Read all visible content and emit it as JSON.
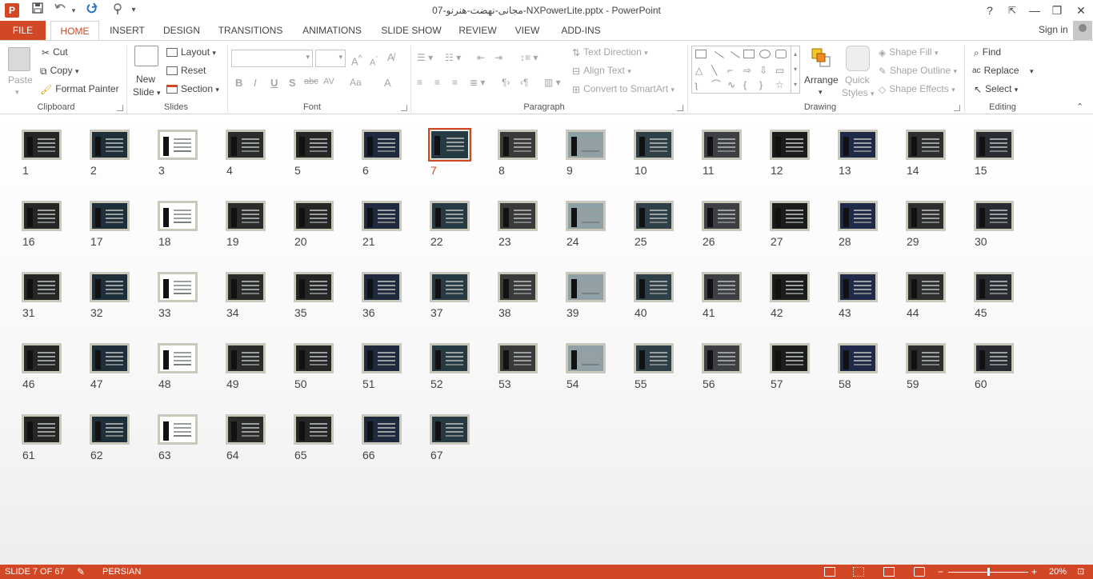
{
  "window": {
    "title": "07-مجانی-نهضت-هنرنو-NXPowerLite.pptx - PowerPoint",
    "help": "?",
    "restore_ribbon": "⇱",
    "minimize": "—",
    "maximize": "❐",
    "close": "✕"
  },
  "qat": {
    "save": "save-icon",
    "undo": "undo-icon",
    "redo": "redo-icon",
    "touch": "touch-mode-icon",
    "customize": "▾"
  },
  "tabs": [
    "FILE",
    "HOME",
    "INSERT",
    "DESIGN",
    "TRANSITIONS",
    "ANIMATIONS",
    "SLIDE SHOW",
    "REVIEW",
    "VIEW",
    "ADD-INS"
  ],
  "active_tab": "HOME",
  "account": {
    "signin": "Sign in"
  },
  "ribbon": {
    "clipboard": {
      "label": "Clipboard",
      "paste": "Paste",
      "cut": "Cut",
      "copy": "Copy",
      "format_painter": "Format Painter"
    },
    "slides": {
      "label": "Slides",
      "new_slide_1": "New",
      "new_slide_2": "Slide",
      "layout": "Layout",
      "reset": "Reset",
      "section": "Section"
    },
    "font": {
      "label": "Font",
      "bold": "B",
      "italic": "I",
      "underline": "U",
      "shadow": "S",
      "strike": "abc",
      "spacing": "AV",
      "case": "Aa",
      "color": "A",
      "grow": "A",
      "shrink": "A"
    },
    "paragraph": {
      "label": "Paragraph",
      "text_direction": "Text Direction",
      "align_text": "Align Text",
      "convert_smartart": "Convert to SmartArt"
    },
    "drawing": {
      "label": "Drawing",
      "arrange": "Arrange",
      "quick_styles_1": "Quick",
      "quick_styles_2": "Styles",
      "shape_fill": "Shape Fill",
      "shape_outline": "Shape Outline",
      "shape_effects": "Shape Effects"
    },
    "editing": {
      "label": "Editing",
      "find": "Find",
      "replace": "Replace",
      "select": "Select"
    }
  },
  "slides": {
    "count": 67,
    "selected": 7,
    "numbers": [
      "1",
      "2",
      "3",
      "4",
      "5",
      "6",
      "7",
      "8",
      "9",
      "10",
      "11",
      "12",
      "13",
      "14",
      "15",
      "16",
      "17",
      "18",
      "19",
      "20",
      "21",
      "22",
      "23",
      "24",
      "25",
      "26",
      "27",
      "28",
      "29",
      "30",
      "31",
      "32",
      "33",
      "34",
      "35",
      "36",
      "37",
      "38",
      "39",
      "40",
      "41",
      "42",
      "43",
      "44",
      "45",
      "46",
      "47",
      "48",
      "49",
      "50",
      "51",
      "52",
      "53",
      "54",
      "55",
      "56",
      "57",
      "58",
      "59",
      "60",
      "61",
      "62",
      "63",
      "64",
      "65",
      "66",
      "67"
    ]
  },
  "status": {
    "slide_info": "SLIDE 7 OF 67",
    "language": "PERSIAN",
    "zoom": "20%",
    "zoom_minus": "−",
    "zoom_plus": "+"
  }
}
